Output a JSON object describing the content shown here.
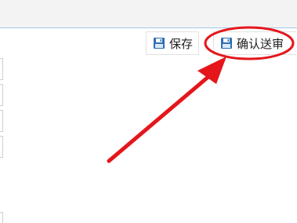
{
  "toolbar": {
    "save_label": "保存",
    "confirm_label": "确认送审"
  },
  "colors": {
    "accent_blue": "#2b6cb0",
    "annotation_red": "#e4161b"
  },
  "icons": {
    "save": "floppy-disk-icon",
    "confirm": "floppy-disk-icon"
  }
}
